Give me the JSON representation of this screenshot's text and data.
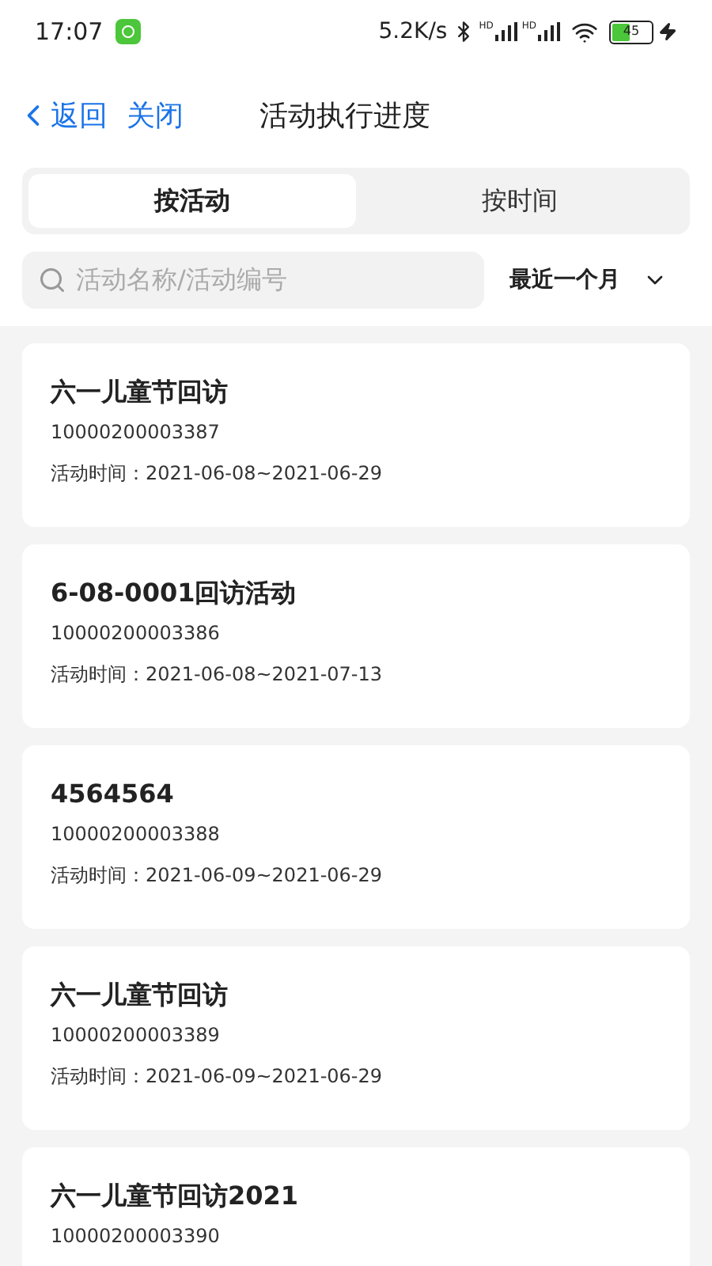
{
  "status_bar": {
    "time": "17:07",
    "net_speed": "5.2K/s",
    "signals": [
      {
        "label": "HD"
      },
      {
        "label": "HD"
      }
    ],
    "battery": {
      "text": "45",
      "level": 0.45
    }
  },
  "nav": {
    "back": "返回",
    "close": "关闭",
    "title": "活动执行进度"
  },
  "tabs": [
    {
      "label": "按活动",
      "selected": true
    },
    {
      "label": "按时间",
      "selected": false
    }
  ],
  "search": {
    "placeholder": "活动名称/活动编号"
  },
  "period_filter": {
    "value": "最近一个月"
  },
  "activities": [
    {
      "name": "六一儿童节回访",
      "code": "10000200003387",
      "period": "活动时间：2021-06-08~2021-06-29"
    },
    {
      "name": "6-08-0001回访活动",
      "code": "10000200003386",
      "period": "活动时间：2021-06-08~2021-07-13"
    },
    {
      "name": "4564564",
      "code": "10000200003388",
      "period": "活动时间：2021-06-09~2021-06-29"
    },
    {
      "name": "六一儿童节回访",
      "code": "10000200003389",
      "period": "活动时间：2021-06-09~2021-06-29"
    },
    {
      "name": "六一儿童节回访2021",
      "code": "10000200003390"
    }
  ]
}
